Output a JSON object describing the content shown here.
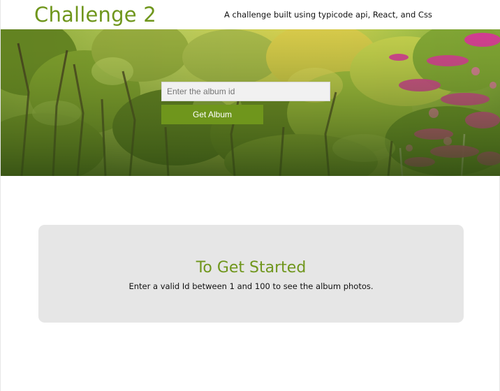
{
  "header": {
    "title": "Challenge 2",
    "tagline": "A challenge built using typicode api, React, and Css"
  },
  "search": {
    "placeholder": "Enter the album id",
    "value": "",
    "button_label": "Get Album"
  },
  "hero": {
    "image": "forest-with-pink-blossoms"
  },
  "info": {
    "title": "To Get Started",
    "text": "Enter a valid Id between 1 and 100 to see the album photos."
  },
  "colors": {
    "accent": "#6f961c",
    "card_bg": "#e6e6e6"
  }
}
